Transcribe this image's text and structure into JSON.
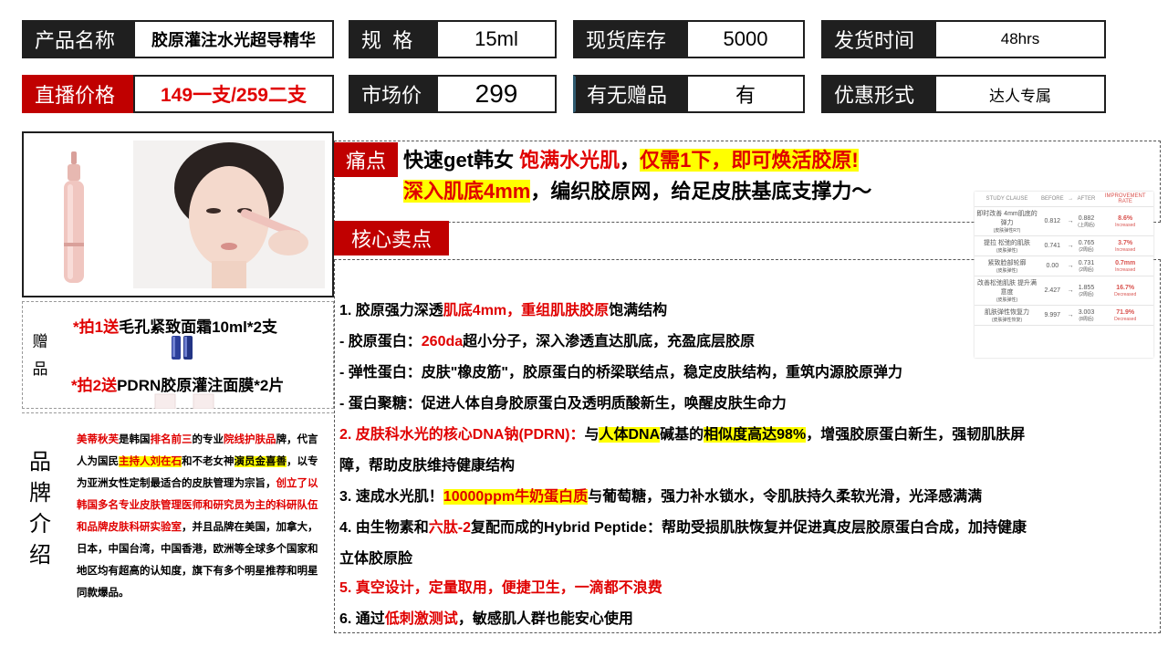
{
  "header": {
    "row1": [
      {
        "label": "产品名称",
        "value": "胶原灌注水光超导精华"
      },
      {
        "label": "规  格",
        "value": "15ml"
      },
      {
        "label": "现货库存",
        "value": "5000"
      },
      {
        "label": "发货时间",
        "value": "48hrs"
      }
    ],
    "row2": [
      {
        "label": "直播价格",
        "value": "149一支/259二支"
      },
      {
        "label": "市场价",
        "value": "299"
      },
      {
        "label": "有无赠品",
        "value": "有"
      },
      {
        "label": "优惠形式",
        "value": "达人专属"
      }
    ]
  },
  "pain": {
    "tag": "痛点",
    "l1a": "快速get韩女 ",
    "l1b": "饱满水光肌",
    "l1c": "，",
    "l1d": "仅需1下，即可焕活胶原!",
    "l2a": "深入肌底4mm",
    "l2b": "，编织胶原网，给足皮肤基底支撑力～"
  },
  "core": {
    "tag": "核心卖点"
  },
  "selling": {
    "p1a": "1. 胶原强力深透",
    "p1b": "肌底4mm，重组肌肤胶原",
    "p1c": "饱满结构",
    "p2a": "- 胶原蛋白：",
    "p2b": "260da",
    "p2c": "超小分子，深入渗透直达肌底，充盈底层胶原",
    "p3": "- 弹性蛋白：皮肤\"橡皮筋\"，胶原蛋白的桥梁联结点，稳定皮肤结构，重筑内源胶原弹力",
    "p4": "- 蛋白聚糖：促进人体自身胶原蛋白及透明质酸新生，唤醒皮肤生命力",
    "p5a": "2. 皮肤科水光的核心DNA钠(PDRN)：",
    "p5b": "与",
    "p5c": "人体DNA",
    "p5d": "碱基的",
    "p5e": "相似度高达98%",
    "p5f": "，增强胶原蛋白新生，强韧肌肤屏",
    "p5g": "障，帮助皮肤维持健康结构",
    "p6a": "3. 速成水光肌！",
    "p6b": "10000ppm牛奶蛋白质",
    "p6c": "与葡萄糖，强力补水锁水，令肌肤持久柔软光滑，光泽感满满",
    "p7a": "4. 由生物素和",
    "p7b": "六肽-2",
    "p7c": "复配而成的Hybrid Peptide：帮助受损肌肤恢复并促进真皮层胶原蛋白合成，加持健康",
    "p7d": "立体胶原脸",
    "p8": "5. 真空设计，定量取用，便捷卫生，一滴都不浪费",
    "p9a": "6. 通过",
    "p9b": "低刺激测试",
    "p9c": "，敏感肌人群也能安心使用"
  },
  "gift": {
    "side": [
      "赠",
      "品"
    ],
    "g1a": "*拍1送",
    "g1b": "毛孔紧致面霜10ml*2支",
    "g2a": "*拍2送",
    "g2b": "PDRN胶原灌注面膜*2片"
  },
  "brand": {
    "side": [
      "品",
      "牌",
      "介",
      "绍"
    ],
    "t1": "美蒂秋芙",
    "t2": "是韩国",
    "t3": "排名前三",
    "t4": "的专业",
    "t5": "院线护肤品",
    "t6": "牌，代言人为国民",
    "t7": "主持人刘在石",
    "t8": "和不老女神",
    "t9": "演员金喜善",
    "t10": "，以专为亚洲女性定制最适合的皮肤管理为宗旨，",
    "t11": "创立了以韩国多名专业皮肤管理医师和研究员为主的科研队伍和品牌皮肤科研实验室",
    "t12": "，并且品牌在美国，加拿大，日本，中国台湾，中国香港，欧洲等全球多个国家和地区均有超高的认知度，旗下有多个明星推荐和明星同款爆品。"
  },
  "study": {
    "headers": [
      "STUDY CLAUSE",
      "BEFORE",
      "→",
      "AFTER",
      "IMPROVEMENT RATE"
    ],
    "rows": [
      {
        "c": "即时改善 4mm肌底的弹力",
        "sub": "(皮肤弹性R7)",
        "b": "0.812",
        "a": "0.882",
        "asub": "(上周后)",
        "r": "8.6%",
        "rs": "Increased"
      },
      {
        "c": "提拉 松弛的肌肤",
        "sub": "(皮肤弹性)",
        "b": "0.741",
        "a": "0.765",
        "asub": "(2周后)",
        "r": "3.7%",
        "rs": "Increased"
      },
      {
        "c": "紧致脸部轮廓",
        "sub": "(皮肤弹性)",
        "b": "0.00",
        "a": "0.731",
        "asub": "(2周后)",
        "r": "0.7mm",
        "rs": "Increased"
      },
      {
        "c": "改善松弛肌肤 提升满意度",
        "sub": "(皮肤弹性)",
        "b": "2.427",
        "a": "1.855",
        "asub": "(2周后)",
        "r": "16.7%",
        "rs": "Decreased"
      },
      {
        "c": "肌肤弹性恢复力",
        "sub": "(皮肤弹性恢复)",
        "b": "9.997",
        "a": "3.003",
        "asub": "(8周后)",
        "r": "71.9%",
        "rs": "Decreased"
      }
    ]
  }
}
